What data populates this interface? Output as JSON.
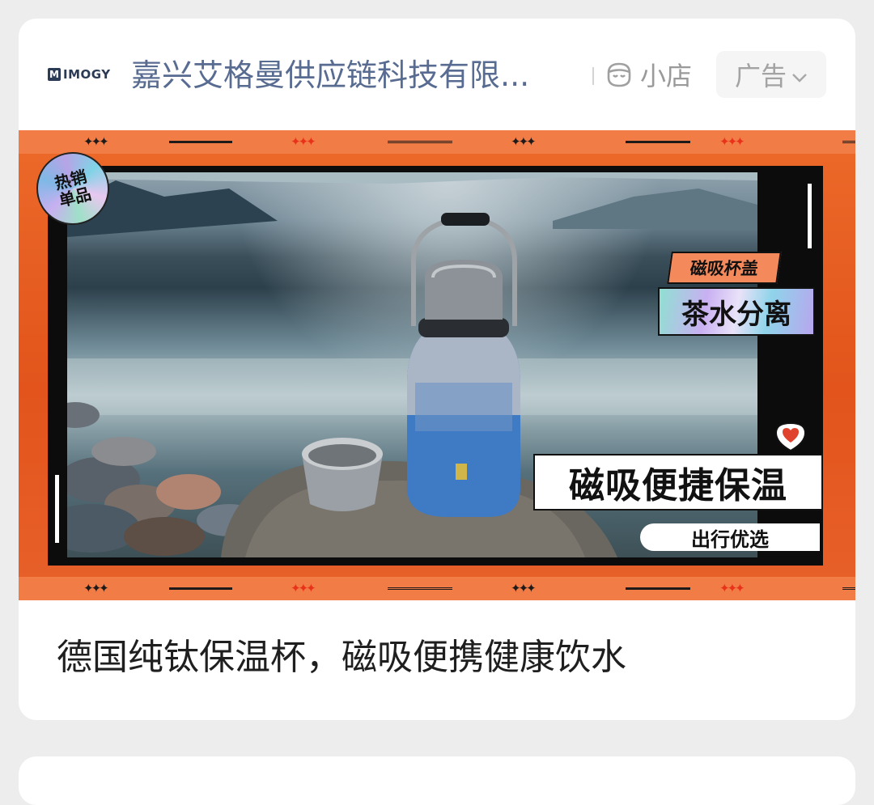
{
  "ad_card": {
    "brand_logo_text": "IMOGY",
    "merchant_name": "嘉兴艾格曼供应链科技有限...",
    "shop_label": "小店",
    "ad_label": "广告",
    "banner": {
      "hot_badge": "热销单品",
      "tag_magnetic_lid": "磁吸杯盖",
      "tag_tea_separation": "茶水分离",
      "tag_headline": "磁吸便捷保温",
      "tag_travel": "出行优选"
    },
    "caption": "德国纯钛保温杯，磁吸便携健康饮水"
  },
  "colors": {
    "page_bg": "#ededed",
    "card_bg": "#ffffff",
    "merchant_text": "#586b91",
    "banner_orange": "#e2541b",
    "caption_text": "#1f1f1f"
  },
  "icons": [
    "imogy-logo-icon",
    "shop-face-icon",
    "chevron-down-icon",
    "heart-icon"
  ]
}
